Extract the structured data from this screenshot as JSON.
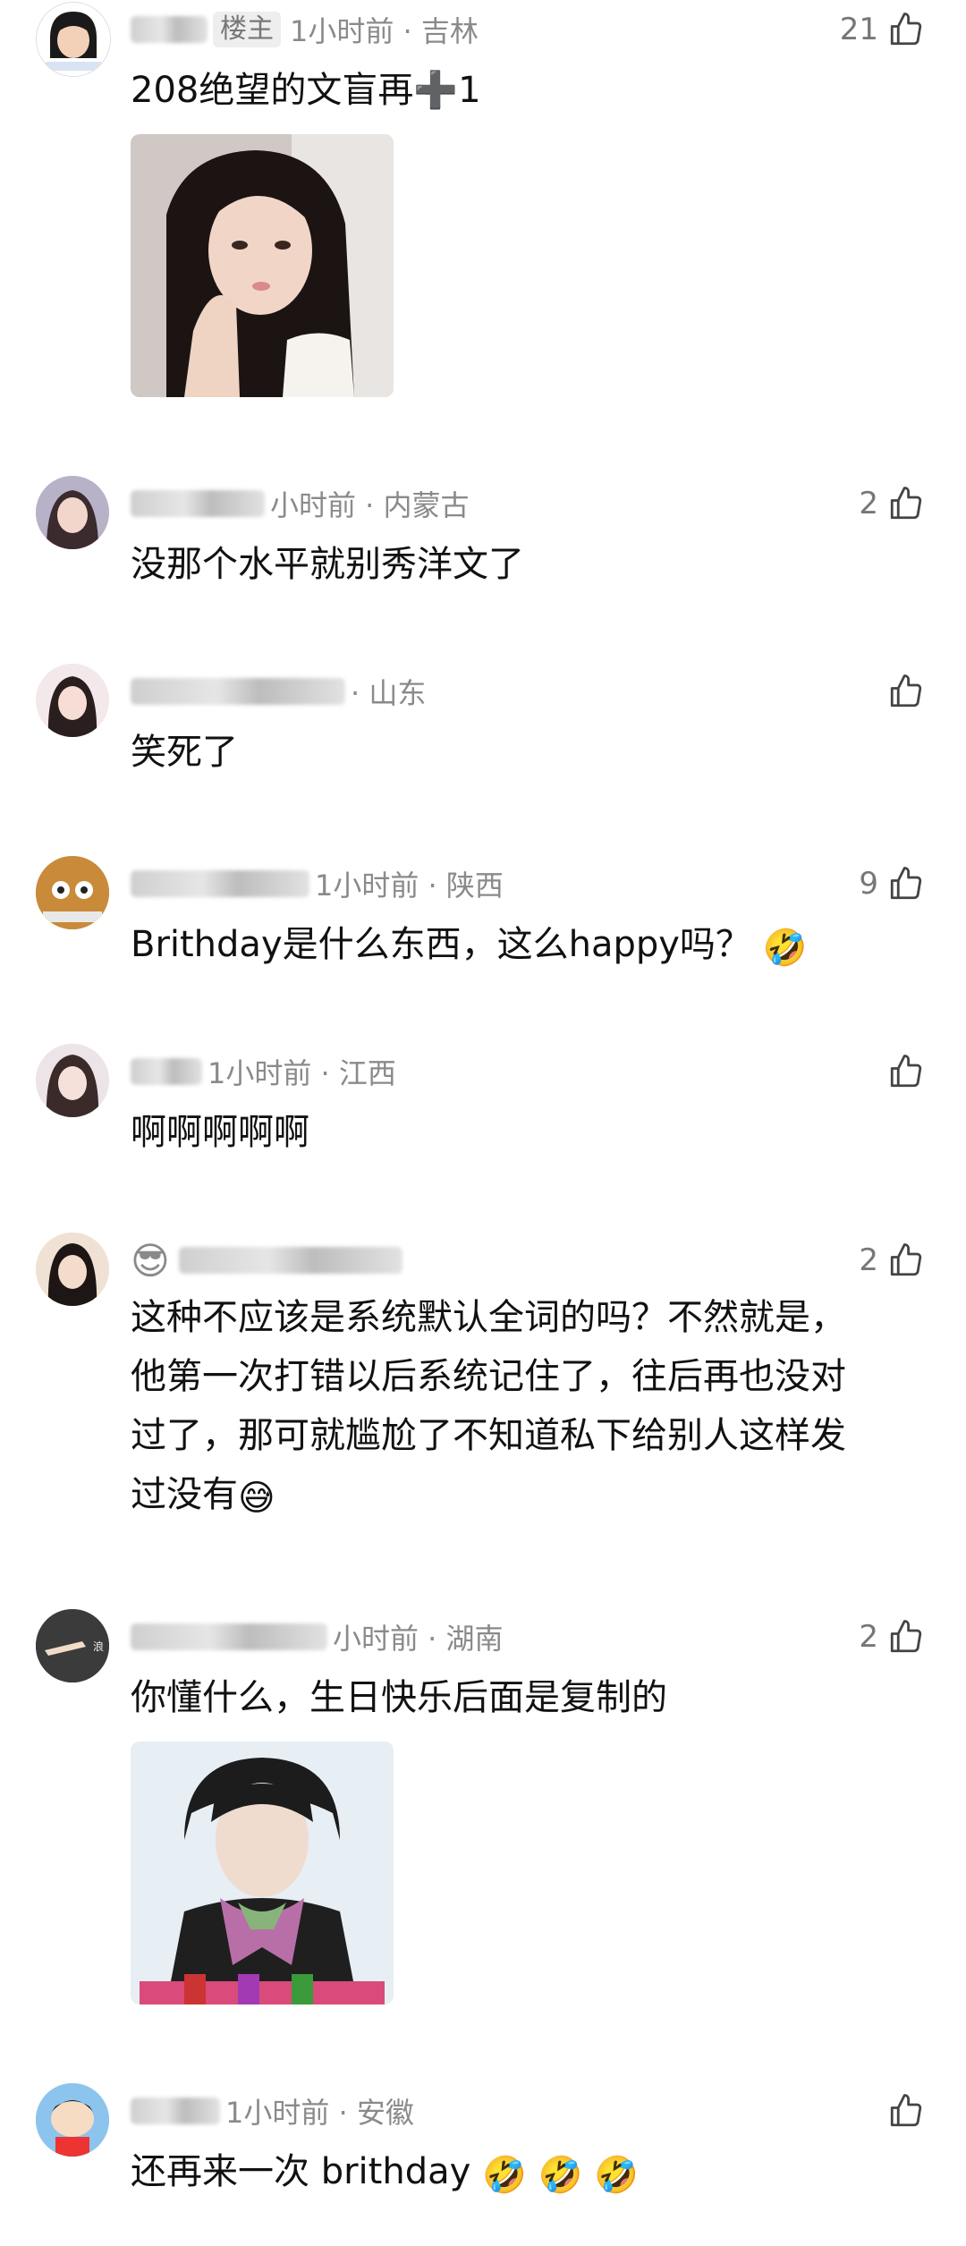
{
  "comments": [
    {
      "badge": "楼主",
      "meta": "1小时前 · 吉林",
      "likes": "21",
      "text": "208绝望的文盲再➕1",
      "has_image": true
    },
    {
      "meta": "小时前 · 内蒙古",
      "likes": "2",
      "text": "没那个水平就别秀洋文了"
    },
    {
      "meta": "· 山东",
      "likes": "",
      "text": "笑死了"
    },
    {
      "meta": "1小时前 · 陕西",
      "likes": "9",
      "text": "Brithday是什么东西，这么happy吗？",
      "emoji": "🤣"
    },
    {
      "meta": "1小时前 · 江西",
      "likes": "",
      "text": "啊啊啊啊啊"
    },
    {
      "meta": "",
      "likes": "2",
      "text_lines": [
        "这种不应该是系统默认全词的吗？不然就是，",
        "他第一次打错以后系统记住了，往后再也没对",
        "过了，那可就尴尬了不知道私下给别人这样发",
        "过没有"
      ],
      "emoji": "😅"
    },
    {
      "meta": "小时前 · 湖南",
      "likes": "2",
      "text": "你懂什么，生日快乐后面是复制的",
      "has_image": true
    },
    {
      "meta": "1小时前 · 安徽",
      "likes": "",
      "text": "还再来一次 brithday",
      "emoji": "🤣 🤣 🤣"
    }
  ],
  "icons": {
    "like": "thumbs-up-icon"
  },
  "colors": {
    "meta": "#8a8a8a",
    "text": "#111111",
    "background": "#ffffff"
  }
}
